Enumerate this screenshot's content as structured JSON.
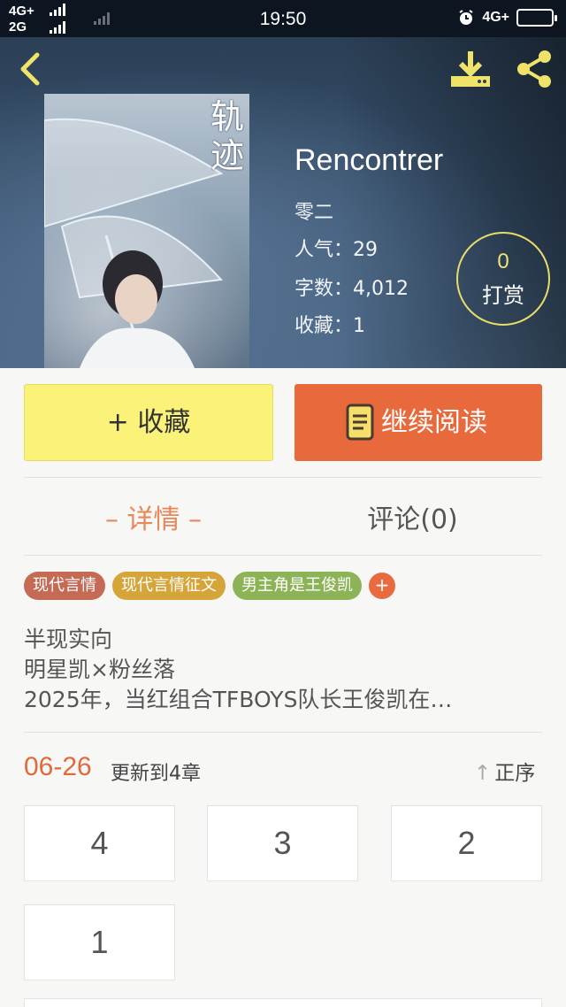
{
  "status_bar": {
    "network_1": "4G+",
    "network_2": "2G",
    "time": "19:50",
    "right_network": "4G+"
  },
  "header": {
    "back_icon": "chevron-left-icon",
    "download_icon": "download-icon",
    "share_icon": "share-icon",
    "cover_title": "轨\n迹",
    "book_title": "Rencontrer",
    "author": "零二",
    "popularity": "人气：29",
    "word_count": "字数：4,012",
    "favorites": "收藏：1",
    "reward_count": "0",
    "reward_label": "打赏"
  },
  "actions": {
    "favorite_label": "+ 收藏",
    "read_label": "继续阅读",
    "read_icon": "book-icon"
  },
  "tabs": {
    "details": "– 详情 –",
    "comments": "评论(0)"
  },
  "tags": [
    "现代言情",
    "现代言情征文",
    "男主角是王俊凯"
  ],
  "tag_add": "+",
  "description": {
    "line1": "半现实向",
    "line2": "明星凯×粉丝落",
    "line3": "2025年，当红组合TFBOYS队长王俊凯在…"
  },
  "update": {
    "date": "06-26",
    "text": "更新到4章",
    "sort_label": "正序",
    "sort_icon": "arrow-up-icon"
  },
  "chapters": [
    "4",
    "3",
    "2",
    "1"
  ],
  "colors": {
    "accent_orange": "#e8693b",
    "favorite_yellow": "#fbf27a",
    "reward_ring": "#e9dd6a"
  }
}
